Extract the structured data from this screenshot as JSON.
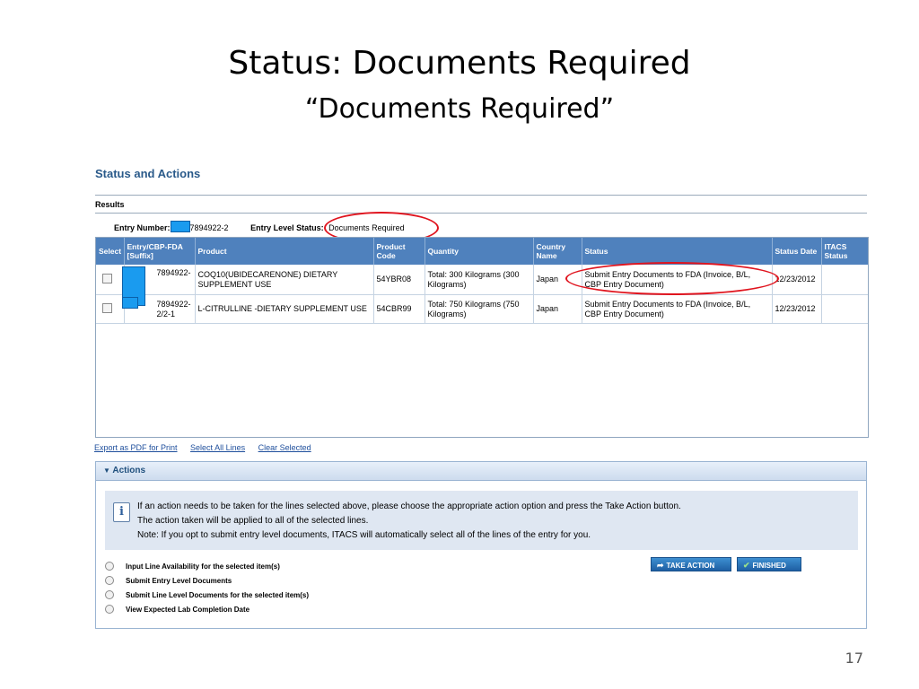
{
  "slide": {
    "title": "Status: Documents Required",
    "subtitle": "“Documents Required”",
    "page_number": "17"
  },
  "section": {
    "title": "Status and Actions",
    "results_label": "Results"
  },
  "entry": {
    "number_label": "Entry Number:",
    "number_suffix": "7894922-2",
    "status_label": "Entry Level Status:",
    "status_value": "Documents Required"
  },
  "table": {
    "headers": [
      "Select",
      "Entry/CBP-FDA [Suffix]",
      "Product",
      "Product Code",
      "Quantity",
      "Country Name",
      "Status",
      "Status Date",
      "ITACS Status"
    ],
    "rows": [
      {
        "entry": "7894922-",
        "product": "COQ10(UBIDECARENONE) DIETARY SUPPLEMENT USE",
        "code": "54YBR08",
        "quantity": "Total: 300 Kilograms (300 Kilograms)",
        "country": "Japan",
        "status": "Submit Entry Documents to FDA (Invoice, B/L, CBP Entry Document)",
        "date": "12/23/2012",
        "itacs": ""
      },
      {
        "entry": "7894922-\n2/2-1",
        "product": "L-CITRULLINE -DIETARY SUPPLEMENT USE",
        "code": "54CBR99",
        "quantity": "Total: 750 Kilograms (750 Kilograms)",
        "country": "Japan",
        "status": "Submit Entry Documents to FDA (Invoice, B/L, CBP Entry Document)",
        "date": "12/23/2012",
        "itacs": ""
      }
    ]
  },
  "links": {
    "export_pdf": "Export as PDF for Print",
    "select_all": "Select All Lines",
    "clear_selected": "Clear Selected"
  },
  "actions": {
    "header": "Actions",
    "info_lines": [
      "If an action needs to be taken for the lines selected above, please choose the appropriate action option and press the Take Action button.",
      "The action taken will be applied to all of the selected lines.",
      "Note: If you opt to submit entry level documents, ITACS will automatically select all of the lines of the entry for you."
    ],
    "options": [
      "Input Line Availability for the selected item(s)",
      "Submit Entry Level Documents",
      "Submit Line Level Documents for the selected item(s)",
      "View Expected Lab Completion Date"
    ],
    "take_action_label": "TAKE ACTION",
    "finished_label": "FINISHED"
  },
  "colors": {
    "header_blue": "#4f81bd",
    "title_blue": "#2a5a8a",
    "annotation_red": "#e0141e",
    "redaction_blue": "#1a9bef",
    "button_blue": "#1e5fa3"
  }
}
